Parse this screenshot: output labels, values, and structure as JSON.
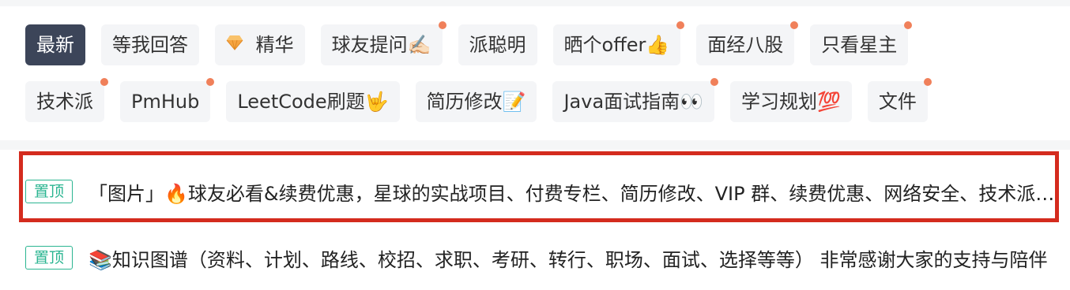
{
  "tags": {
    "row1": [
      {
        "label": "最新",
        "active": true,
        "dot": false
      },
      {
        "label": "等我回答",
        "active": false,
        "dot": false
      },
      {
        "label": "精华",
        "active": false,
        "dot": false,
        "icon": "gem-icon"
      },
      {
        "label": "球友提问✍🏻",
        "active": false,
        "dot": true
      },
      {
        "label": "派聪明",
        "active": false,
        "dot": false
      },
      {
        "label": "晒个offer👍",
        "active": false,
        "dot": true
      },
      {
        "label": "面经八股",
        "active": false,
        "dot": true
      },
      {
        "label": "只看星主",
        "active": false,
        "dot": true
      }
    ],
    "row2": [
      {
        "label": "技术派",
        "active": false,
        "dot": true
      },
      {
        "label": "PmHub",
        "active": false,
        "dot": true
      },
      {
        "label": "LeetCode刷题🤟",
        "active": false,
        "dot": false
      },
      {
        "label": "简历修改📝",
        "active": false,
        "dot": false
      },
      {
        "label": "Java面试指南👀",
        "active": false,
        "dot": true
      },
      {
        "label": "学习规划💯",
        "active": false,
        "dot": false
      },
      {
        "label": "文件",
        "active": false,
        "dot": true
      }
    ]
  },
  "posts": [
    {
      "badge": "置顶",
      "title": "「图片」🔥球友必看&续费优惠，星球的实战项目、付费专栏、简历修改、VIP 群、续费优惠、网络安全、技术派、PmHub、派聪明"
    },
    {
      "badge": "置顶",
      "title": "📚知识图谱（资料、计划、路线、校招、求职、考研、转行、职场、面试、选择等等） 非常感谢大家的支持与陪伴"
    }
  ],
  "colors": {
    "active_tag_bg": "#3c4559",
    "tag_bg": "#f4f5f7",
    "notification_dot": "#f0805a",
    "pin_badge": "#2bb591",
    "highlight_border": "#d42b1e",
    "gem_icon": "#f6a440"
  }
}
